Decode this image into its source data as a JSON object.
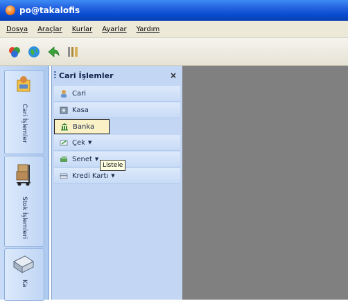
{
  "window": {
    "title": "po@takalofis"
  },
  "menu": {
    "items": [
      "Dosya",
      "Araçlar",
      "Kurlar",
      "Ayarlar",
      "Yardım"
    ],
    "mnemonics": [
      "D",
      "A",
      "K",
      "A",
      "Y"
    ]
  },
  "toolbar": {
    "icons": [
      "modules-icon",
      "globe-icon",
      "back-arrow-icon",
      "tools-icon"
    ]
  },
  "leftstrip": {
    "buttons": [
      {
        "label": "Cari İşlemler",
        "icon": "cari-icon"
      },
      {
        "label": "Stok İşlemleri",
        "icon": "stok-icon"
      },
      {
        "label": "Ka",
        "icon": "kasa-icon"
      }
    ]
  },
  "panel": {
    "title": "Cari İşlemler",
    "close": "×",
    "items": [
      {
        "label": "Cari",
        "icon": "user-icon"
      },
      {
        "label": "Kasa",
        "icon": "safe-icon"
      },
      {
        "label": "Banka",
        "icon": "bank-icon"
      },
      {
        "label": "Çek",
        "icon": "cheque-icon"
      },
      {
        "label": "Senet",
        "icon": "note-icon"
      },
      {
        "label": "Kredi Kartı",
        "icon": "credit-card-icon"
      }
    ],
    "tooltip": "Listele"
  },
  "colors": {
    "titlebar": "#0a4cd1",
    "panel": "#c3d7f4",
    "workspace": "#808080"
  }
}
